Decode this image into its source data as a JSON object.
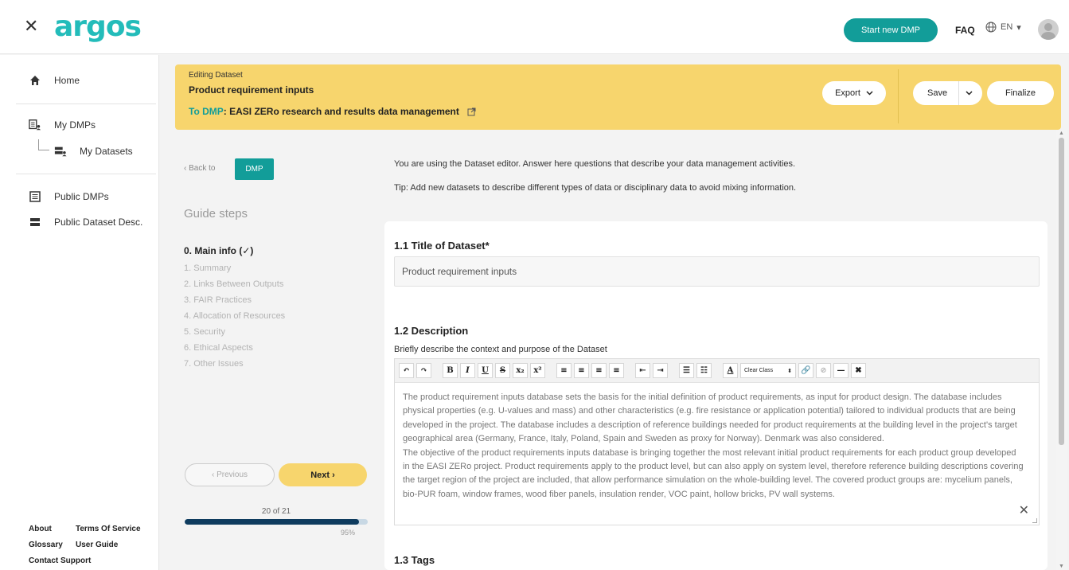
{
  "topbar": {
    "close_glyph": "✕",
    "logo_text": "argos",
    "start_btn": "Start new DMP",
    "faq": "FAQ",
    "lang": "EN",
    "lang_arrow": "▾",
    "brand_color": "#23bcba",
    "accent_color": "#129d99"
  },
  "sidebar": {
    "items": [
      {
        "label": "Home",
        "icon": "home-icon"
      },
      {
        "label": "My DMPs",
        "icon": "my-dmps-icon"
      },
      {
        "label": "My Datasets",
        "icon": "my-datasets-icon"
      },
      {
        "label": "Public DMPs",
        "icon": "public-dmps-icon"
      },
      {
        "label": "Public Dataset Desc.",
        "icon": "public-datasets-icon"
      }
    ],
    "footer": {
      "about": "About",
      "terms": "Terms Of Service",
      "glossary": "Glossary",
      "guide": "User Guide",
      "support": "Contact Support"
    }
  },
  "banner": {
    "subtitle": "Editing Dataset",
    "title": "Product requirement inputs",
    "to_dmp_label": "To DMP",
    "dmp_name": ": EASI ZERo research and results data management",
    "export": "Export",
    "save": "Save",
    "finalize": "Finalize",
    "color": "#f7d56d"
  },
  "guide": {
    "back": "‹  Back to",
    "dmp_btn": "DMP",
    "title": "Guide steps",
    "steps": [
      "0. Main info (✓)",
      "1. Summary",
      "2. Links Between Outputs",
      "3. FAIR Practices",
      "4. Allocation of Resources",
      "5. Security",
      "6. Ethical Aspects",
      "7. Other Issues"
    ],
    "previous": "‹   Previous",
    "next": "Next  ›",
    "progress_text": "20 of 21",
    "progress_pct": "95%",
    "progress_fraction": 0.95
  },
  "main": {
    "intro1": "You are using the Dataset editor. Answer here questions that describe your data management activities.",
    "intro2": "Tip: Add new datasets to describe different types of data or disciplinary data to avoid mixing information.",
    "q1_title": "1.1 Title of Dataset*",
    "q1_value": "Product requirement inputs",
    "q2_title": "1.2 Description",
    "q2_hint": "Briefly describe the context and purpose of the Dataset",
    "toolbar": {
      "undo": "↶",
      "redo": "↷",
      "bold": "B",
      "italic": "I",
      "underline": "U",
      "strike": "S",
      "sub": "x₂",
      "sup": "x²",
      "align_left": "≡",
      "align_center": "≡",
      "align_right": "≡",
      "justify": "≡",
      "outdent": "⇤",
      "indent": "⇥",
      "ul": "☰",
      "ol": "☷",
      "font_color": "A",
      "clear_class": "Clear Class",
      "link": "🔗",
      "unlink": "⊘",
      "hr": "—",
      "remove": "✖"
    },
    "q2_para1": "The product requirement inputs database sets the basis for the initial definition of product requirements, as input for product design. The database includes physical properties (e.g. U-values and mass) and other characteristics (e.g. fire resistance or application potential) tailored to individual products that are being developed in the project. The database includes a description of reference buildings needed for product requirements at the building level in the project's target geographical area (Germany, France, Italy, Poland, Spain and Sweden as proxy for Norway). Denmark was also considered.",
    "q2_para2": "The objective of the product requirements inputs database is bringing together the most relevant initial product requirements for each product group developed in the EASI ZERo project. Product requirements apply to the product level, but can also apply on system level, therefore reference building descriptions covering the target region of the project are included, that allow performance simulation on the whole-building level. The covered product groups are: mycelium panels, bio-PUR foam, window frames, wood fiber panels, insulation render, VOC paint, hollow bricks, PV wall systems.",
    "q3_title": "1.3 Tags",
    "close_glyph": "✕"
  }
}
